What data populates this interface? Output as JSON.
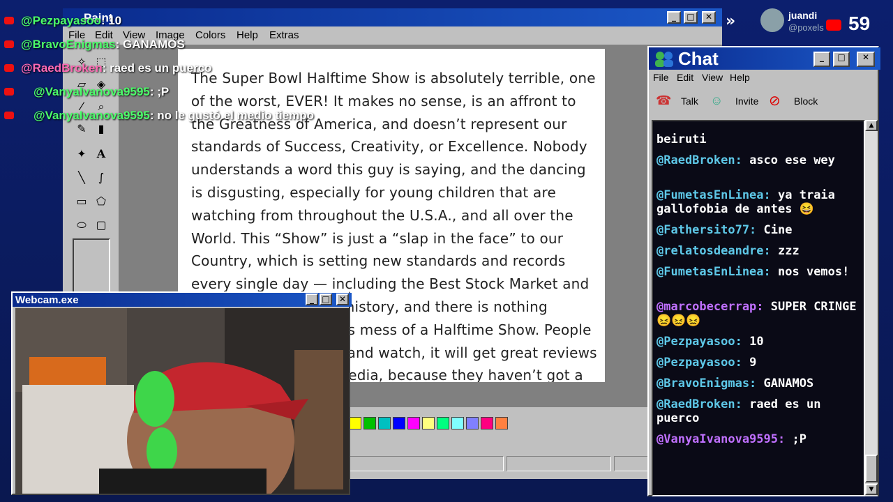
{
  "paint": {
    "title": "Paint",
    "menus": [
      "File",
      "Edit",
      "View",
      "Image",
      "Colors",
      "Help",
      "Extras"
    ],
    "document_text": "The Super Bowl Halftime Show is absolutely terrible, one of the worst, EVER! It makes no sense, is an affront to the Greatness of America, and doesn’t represent our standards of Success, Creativity, or Excellence. Nobody understands a word this guy is saying, and the dancing is disgusting, especially for young children that are watching from throughout the U.S.A., and all over the World. This “Show” is just a “slap in the face” to our Country, which is setting new standards and records every single day — including the Best Stock Market and the highest 401k’s in history, and there is nothing inspirational about this mess of a Halftime Show. People will turn off the Show and watch, it will get great reviews from the Fake News Media, because they haven’t got a clue what is going on in the REAL WORLD — And",
    "palette": [
      "#ffff00",
      "#00c000",
      "#00c0c0",
      "#0000ff",
      "#ff00ff",
      "#ffff80",
      "#00ff80",
      "#80ffff",
      "#8080ff",
      "#ff0080",
      "#ff8040"
    ]
  },
  "overlay_chat": [
    {
      "user": "@Pezpayasoo",
      "text": ": 10",
      "user_color": "#4cff6a"
    },
    {
      "user": "@BravoEnigmas",
      "text": ": GANAMOS",
      "user_color": "#4cff6a"
    },
    {
      "user": "@RaedBroken",
      "text": ": raed es un puerco",
      "user_color": "#ff6ab4"
    },
    {
      "user": "@VanyaIvanova9595",
      "text": ": ;P",
      "user_color": "#4cff6a"
    },
    {
      "user": "@VanyaIvanova9595",
      "text": ": no le gustó el medio tiempo",
      "user_color": "#4cff6a"
    }
  ],
  "chat": {
    "title": "Chat",
    "menus": [
      "File",
      "Edit",
      "View",
      "Help"
    ],
    "tools": [
      "Talk",
      "Invite",
      "Block"
    ],
    "messages": [
      {
        "user": "",
        "text": "beiruti",
        "color": "#ffffff"
      },
      {
        "user": "@RaedBroken:",
        "text": "asco ese wey",
        "color": "#5ec8e8"
      },
      {
        "user": "@FumetasEnLinea:",
        "text": "ya traia gallofobia de antes 😆",
        "color": "#5ec8e8"
      },
      {
        "user": "@Fathersito77:",
        "text": "Cine",
        "color": "#5ec8e8"
      },
      {
        "user": "@relatosdeandre:",
        "text": "zzz",
        "color": "#5ec8e8"
      },
      {
        "user": "@FumetasEnLinea:",
        "text": "nos vemos!",
        "color": "#5ec8e8"
      },
      {
        "user": "@marcobecerrap:",
        "text": "SUPER CRINGE😖😖😖",
        "color": "#c070ff"
      },
      {
        "user": "@Pezpayasoo:",
        "text": "10",
        "color": "#5ec8e8"
      },
      {
        "user": "@Pezpayasoo:",
        "text": "9",
        "color": "#5ec8e8"
      },
      {
        "user": "@BravoEnigmas:",
        "text": "GANAMOS",
        "color": "#5ec8e8"
      },
      {
        "user": "@RaedBroken:",
        "text": "raed es un puerco",
        "color": "#5ec8e8"
      },
      {
        "user": "@VanyaIvanova9595:",
        "text": ";P",
        "color": "#c070ff"
      }
    ]
  },
  "webcam": {
    "title": "Webcam.exe"
  },
  "youtube": {
    "name": "juandi",
    "handle": "@poxels",
    "count": "59"
  }
}
